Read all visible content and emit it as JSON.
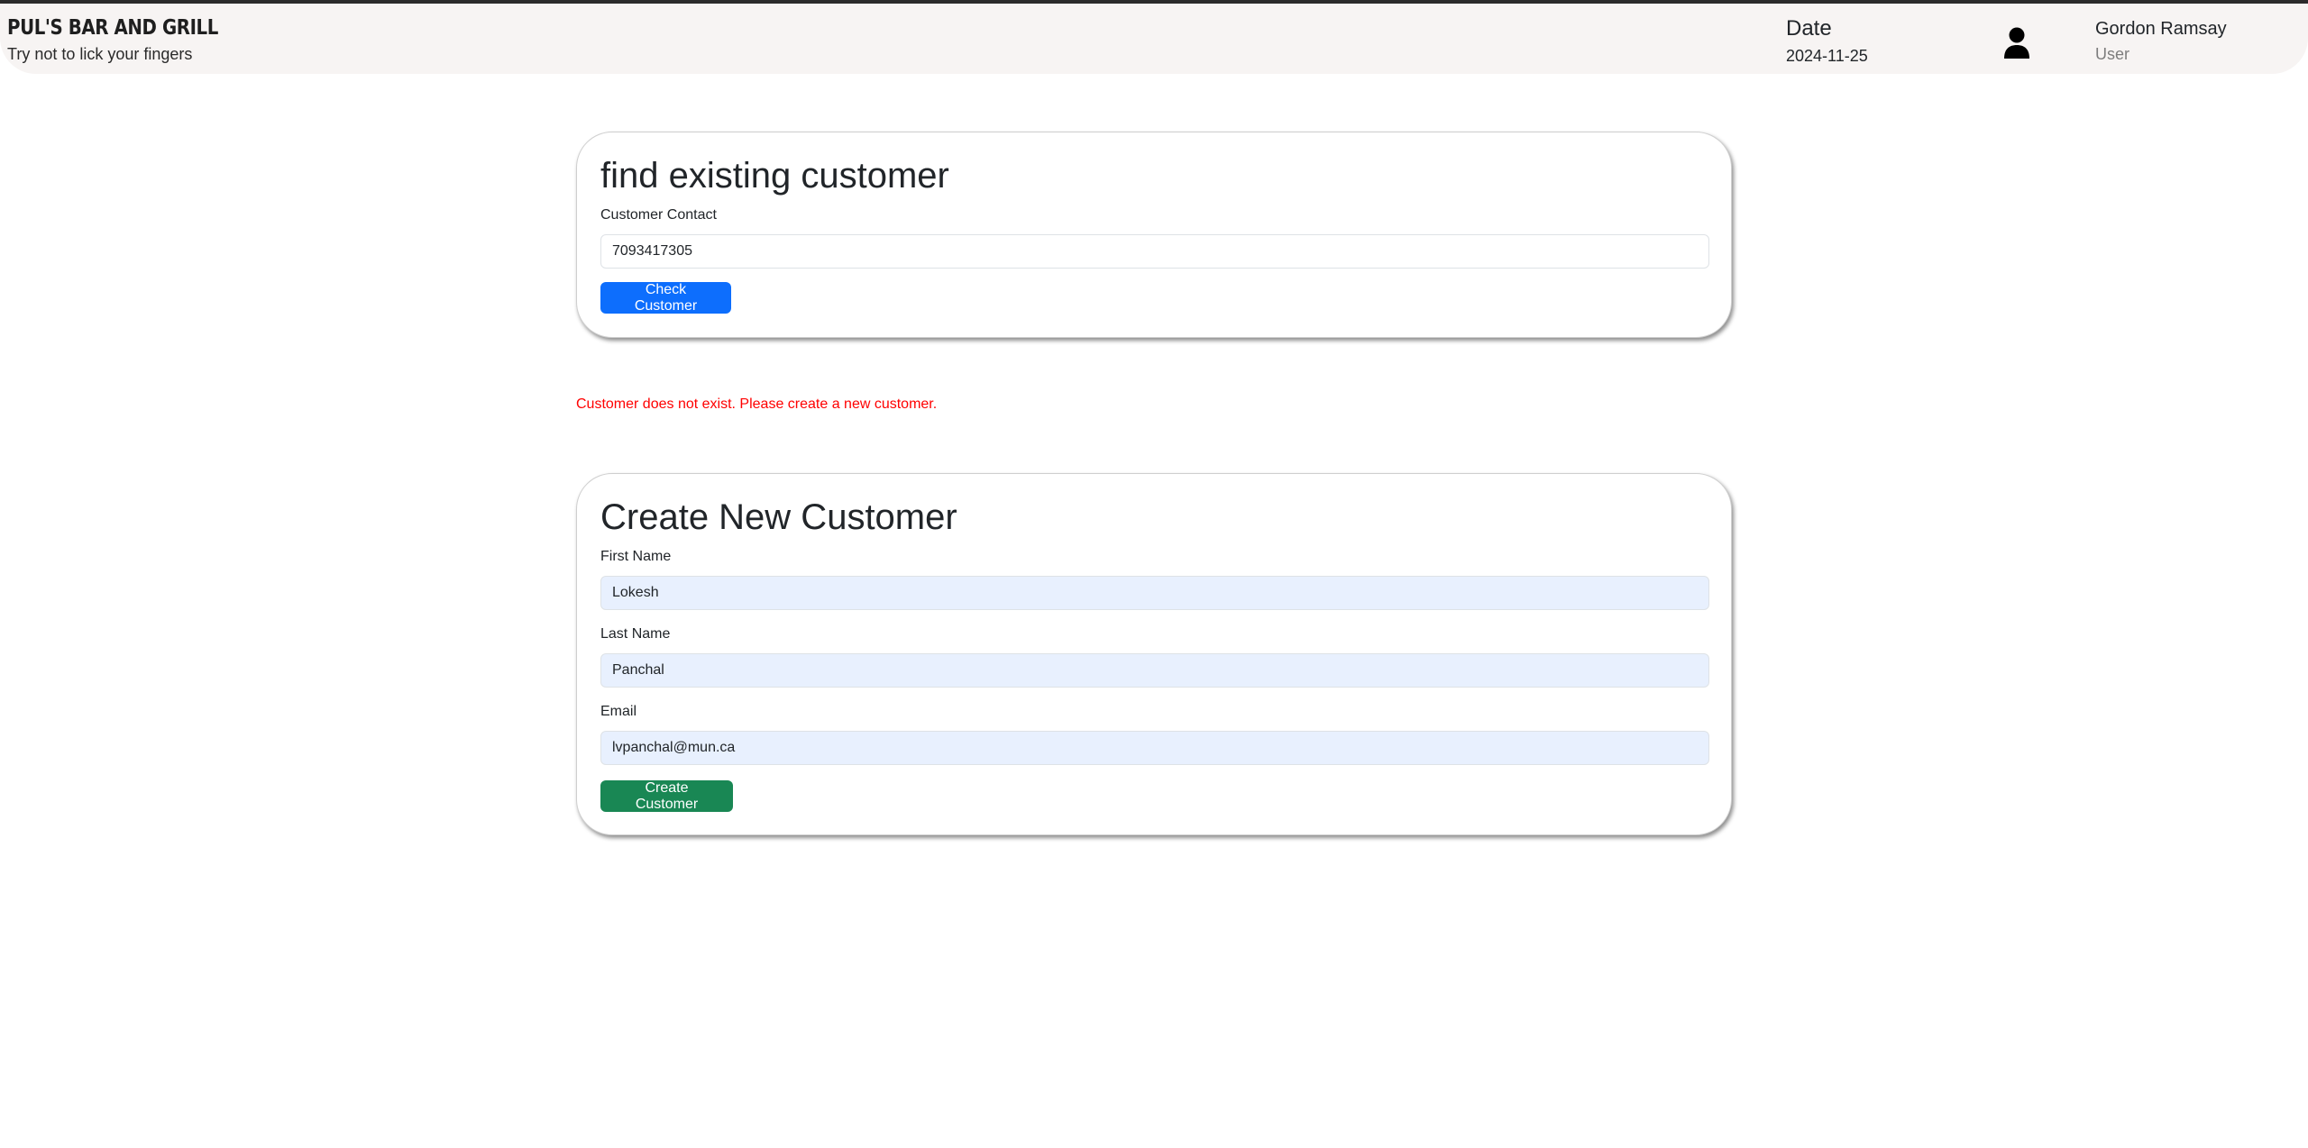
{
  "header": {
    "brand_title": "PUL'S BAR AND GRILL",
    "brand_tagline": "Try not to lick your fingers",
    "date_label": "Date",
    "date_value": "2024-11-25",
    "user_name": "Gordon Ramsay",
    "user_role": "User",
    "avatar_icon": "user-icon"
  },
  "find_customer": {
    "title": "find existing customer",
    "contact_label": "Customer Contact",
    "contact_value": "7093417305",
    "check_button": "Check Customer"
  },
  "message": {
    "error_text": "Customer does not exist. Please create a new customer.",
    "error_color": "#ff0000"
  },
  "create_customer": {
    "title": "Create New Customer",
    "first_name_label": "First Name",
    "first_name_value": "Lokesh",
    "last_name_label": "Last Name",
    "last_name_value": "Panchal",
    "email_label": "Email",
    "email_value": "lvpanchal@mun.ca",
    "create_button": "Create Customer"
  },
  "colors": {
    "primary": "#0d6efd",
    "success": "#198754",
    "autofill_bg": "#e8f0fe",
    "header_bg": "#f7f4f3"
  }
}
